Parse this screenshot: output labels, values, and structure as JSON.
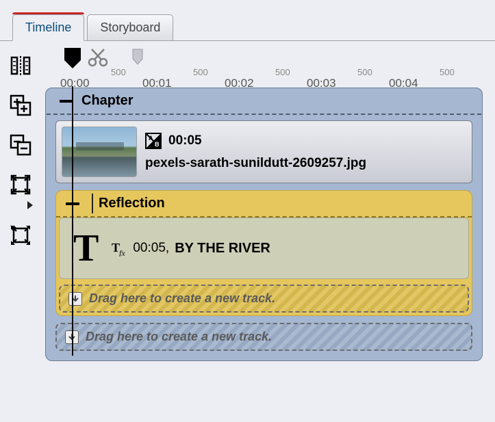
{
  "tabs": {
    "timeline": "Timeline",
    "storyboard": "Storyboard"
  },
  "ruler": {
    "major_labels": [
      "00:00",
      "00:01",
      "00:02",
      "00:03",
      "00:04"
    ],
    "minor_label": "500"
  },
  "chapter": {
    "title": "Chapter",
    "clip": {
      "duration": "00:05",
      "filename": "pexels-sarath-sunildutt-2609257.jpg"
    }
  },
  "reflection": {
    "title": "Reflection",
    "clip": {
      "duration": "00:05,",
      "text": "BY THE RIVER"
    }
  },
  "dropzone_text": "Drag here to create a new track."
}
